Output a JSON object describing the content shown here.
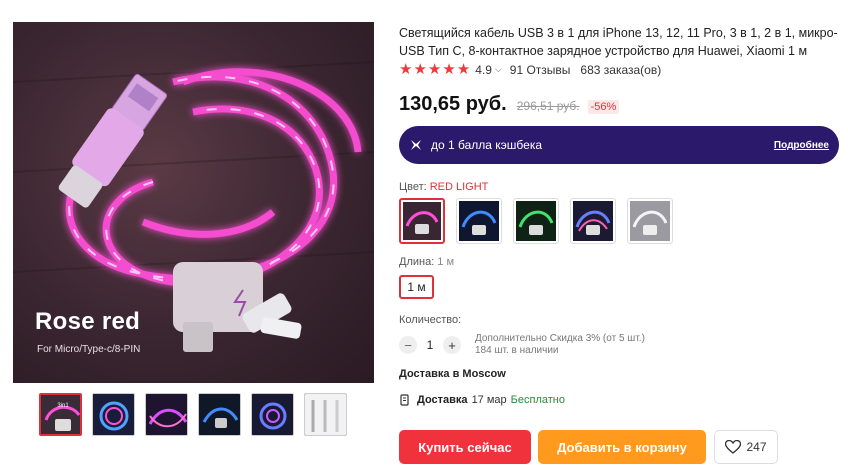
{
  "product": {
    "title": "Светящийся кабель USB 3 в 1 для iPhone 13, 12, 11 Pro, 3 в 1, 2 в 1, микро-USB Тип С, 8-контактное зарядное устройство для Huawei, Xiaomi 1 м",
    "rating": "4.9",
    "rating_stars": 5,
    "reviews": "91 Отзывы",
    "orders": "683 заказа(ов)",
    "price": "130,65 руб.",
    "old_price": "296,51 руб.",
    "discount": "-56%"
  },
  "gallery": {
    "caption_title": "Rose red",
    "caption_sub": "For Micro/Type-c/8-PIN",
    "thumb_badge": "3in1",
    "thumbnails": [
      "pink",
      "blue-multi",
      "pink-purple",
      "blue",
      "blue-purple",
      "white"
    ]
  },
  "cashback": {
    "text": "до 1 балла кэшбека",
    "more": "Подробнее"
  },
  "color": {
    "label": "Цвет:",
    "selected": "RED LIGHT",
    "options": [
      "pink",
      "blue",
      "green",
      "multicolor",
      "white"
    ]
  },
  "length": {
    "label": "Длина:",
    "selected": "1 м",
    "option": "1 м"
  },
  "quantity": {
    "label": "Количество:",
    "minus": "−",
    "value": "1",
    "plus": "+",
    "extra_discount": "Дополнительно Скидка 3% (от 5 шт.)",
    "stock": "184 шт. в наличии"
  },
  "delivery": {
    "to": "Доставка в Moscow",
    "label": "Доставка",
    "date": "17 мар",
    "price": "Бесплатно"
  },
  "actions": {
    "buy_now": "Купить сейчас",
    "add_to_cart": "Добавить в корзину",
    "wishlist_count": "247"
  },
  "colors": {
    "accent_red": "#f0323c",
    "cart_orange": "#ff9a1f",
    "cashback_bg": "#2b1a6b",
    "star": "#ee3a3a",
    "free_green": "#2a8a3a"
  }
}
